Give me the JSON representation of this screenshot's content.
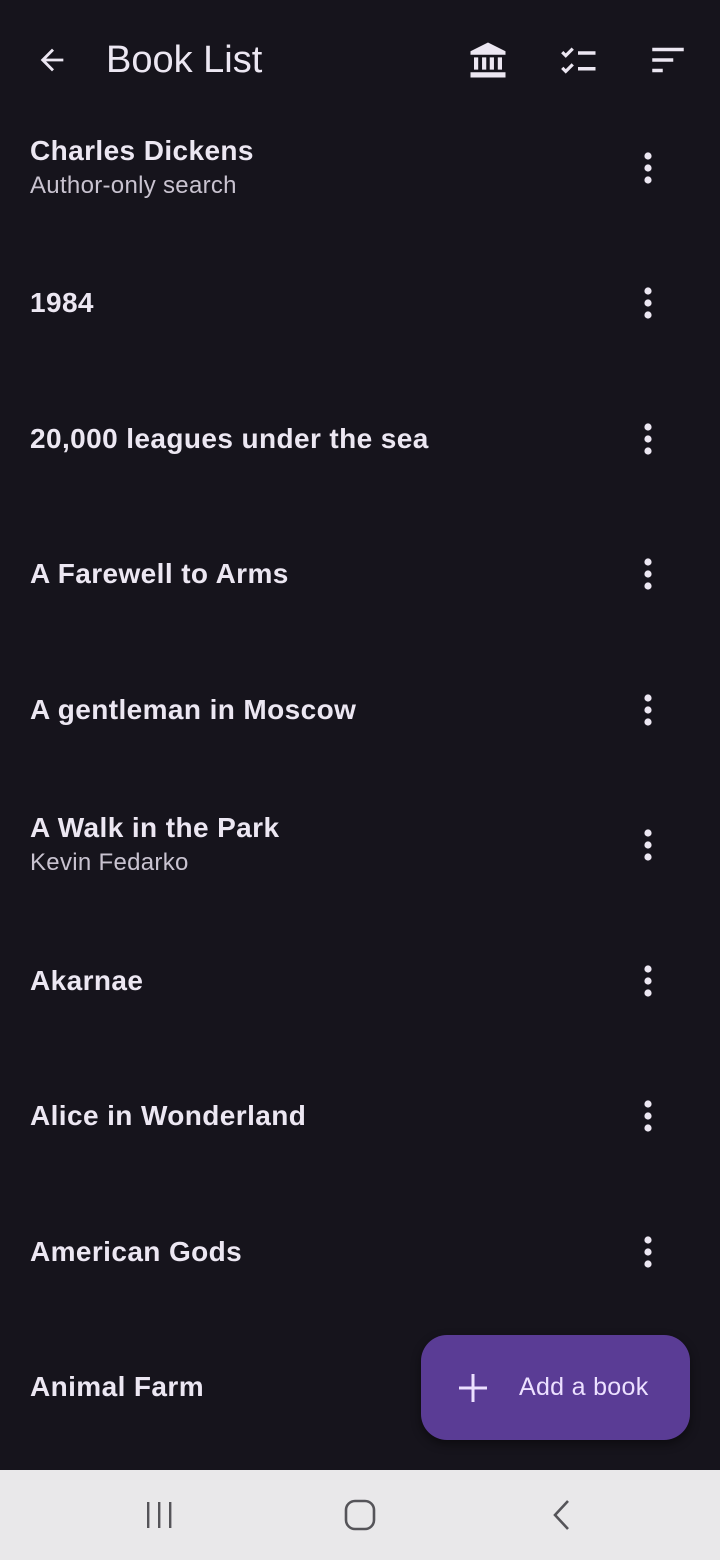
{
  "appbar": {
    "title": "Book List",
    "icons": [
      "arrow-back-icon",
      "library-icon",
      "checklist-icon",
      "sort-icon"
    ]
  },
  "books": [
    {
      "title": "Charles Dickens",
      "subtitle": "Author-only search"
    },
    {
      "title": "1984",
      "subtitle": ""
    },
    {
      "title": "20,000 leagues under the sea",
      "subtitle": ""
    },
    {
      "title": "A Farewell to Arms",
      "subtitle": ""
    },
    {
      "title": "A gentleman in Moscow",
      "subtitle": ""
    },
    {
      "title": "A Walk in the Park",
      "subtitle": "Kevin Fedarko"
    },
    {
      "title": "Akarnae",
      "subtitle": ""
    },
    {
      "title": "Alice in Wonderland",
      "subtitle": ""
    },
    {
      "title": "American Gods",
      "subtitle": ""
    },
    {
      "title": "Animal Farm",
      "subtitle": ""
    }
  ],
  "fab": {
    "label": "Add a book",
    "icon": "plus-icon"
  },
  "system_nav": {
    "icons": [
      "recents-icon",
      "home-icon",
      "back-nav-icon"
    ]
  },
  "colors": {
    "background": "#16141c",
    "text": "#ece7f2",
    "secondary_text": "#c9c3d0",
    "fab": "#5a3c95",
    "navbar": "#e9e8ea"
  }
}
